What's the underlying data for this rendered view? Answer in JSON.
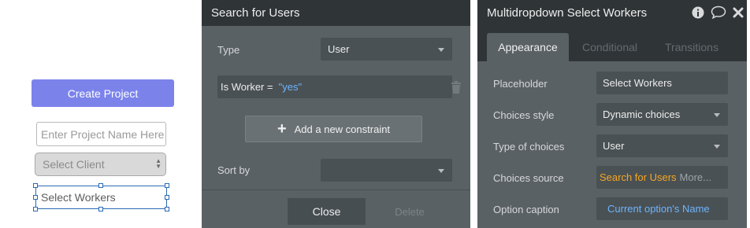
{
  "canvas": {
    "create_button": "Create Project",
    "project_name_placeholder": "Enter Project Name Here",
    "client_select": "Select Client",
    "workers_select": "Select Workers"
  },
  "search_panel": {
    "title": "Search for Users",
    "type_label": "Type",
    "type_value": "User",
    "constraint_field": "Is Worker =",
    "constraint_value": "\"yes\"",
    "add_constraint": "Add a new constraint",
    "sort_label": "Sort by",
    "sort_value": "",
    "close_button": "Close",
    "delete_button": "Delete"
  },
  "property_editor": {
    "title": "Multidropdown Select Workers",
    "tabs": [
      "Appearance",
      "Conditional",
      "Transitions"
    ],
    "active_tab": "Appearance",
    "rows": {
      "placeholder": {
        "label": "Placeholder",
        "value": "Select Workers"
      },
      "choices_style": {
        "label": "Choices style",
        "value": "Dynamic choices"
      },
      "type_of_choices": {
        "label": "Type of choices",
        "value": "User"
      },
      "choices_source": {
        "label": "Choices source",
        "value": "Search for Users",
        "more": "More..."
      },
      "option_caption": {
        "label": "Option caption",
        "value": "Current option's Name"
      }
    },
    "icons": [
      "info-icon",
      "comment-icon",
      "close-icon"
    ]
  },
  "colors": {
    "accent_button": "#7b83eb",
    "panel_bg": "#5a6165",
    "panel_header": "#2f3437",
    "expression_blue": "#6cb4ff",
    "expression_orange": "#f5a623",
    "selection_outline": "#2a6ab5"
  }
}
